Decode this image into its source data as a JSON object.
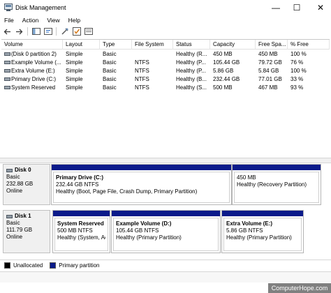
{
  "window": {
    "title": "Disk Management"
  },
  "window_controls": {
    "minimize": "—",
    "maximize": "☐",
    "close": "✕"
  },
  "menu": [
    "File",
    "Action",
    "View",
    "Help"
  ],
  "toolbar": {
    "icons": [
      "back-arrow-icon",
      "forward-arrow-icon",
      "console-tree-icon",
      "help-icon",
      "properties-icon",
      "check-icon",
      "view-icon"
    ]
  },
  "volume_list": {
    "columns": [
      "Volume",
      "Layout",
      "Type",
      "File System",
      "Status",
      "Capacity",
      "Free Spa...",
      "% Free"
    ],
    "rows": [
      [
        "(Disk 0 partition 2)",
        "Simple",
        "Basic",
        "",
        "Healthy (R...",
        "450 MB",
        "450 MB",
        "100 %"
      ],
      [
        "Example Volume (...",
        "Simple",
        "Basic",
        "NTFS",
        "Healthy (P...",
        "105.44 GB",
        "79.72 GB",
        "76 %"
      ],
      [
        "Extra Volume (E:)",
        "Simple",
        "Basic",
        "NTFS",
        "Healthy (P...",
        "5.86 GB",
        "5.84 GB",
        "100 %"
      ],
      [
        "Primary Drive (C:)",
        "Simple",
        "Basic",
        "NTFS",
        "Healthy (B...",
        "232.44 GB",
        "77.01 GB",
        "33 %"
      ],
      [
        "System Reserved",
        "Simple",
        "Basic",
        "NTFS",
        "Healthy (S...",
        "500 MB",
        "467 MB",
        "93 %"
      ]
    ]
  },
  "disks": [
    {
      "name": "Disk 0",
      "type": "Basic",
      "size": "232.88 GB",
      "status": "Online",
      "partitions": [
        {
          "name": "Primary Drive  (C:)",
          "size": "232.44 GB NTFS",
          "status": "Healthy (Boot, Page File, Crash Dump, Primary Partition)"
        },
        {
          "name": "",
          "size": "450 MB",
          "status": "Healthy (Recovery Partition)"
        }
      ]
    },
    {
      "name": "Disk 1",
      "type": "Basic",
      "size": "111.79 GB",
      "status": "Online",
      "partitions": [
        {
          "name": "System Reserved",
          "size": "500 MB NTFS",
          "status": "Healthy (System, Act"
        },
        {
          "name": "Example Volume  (D:)",
          "size": "105.44 GB NTFS",
          "status": "Healthy (Primary Partition)"
        },
        {
          "name": "Extra Volume  (E:)",
          "size": "5.86 GB NTFS",
          "status": "Healthy (Primary Partition)"
        }
      ]
    }
  ],
  "legend": [
    {
      "label": "Unallocated",
      "color": "#000000"
    },
    {
      "label": "Primary partition",
      "color": "#0a1a8a"
    }
  ],
  "watermark": "ComputerHope.com"
}
